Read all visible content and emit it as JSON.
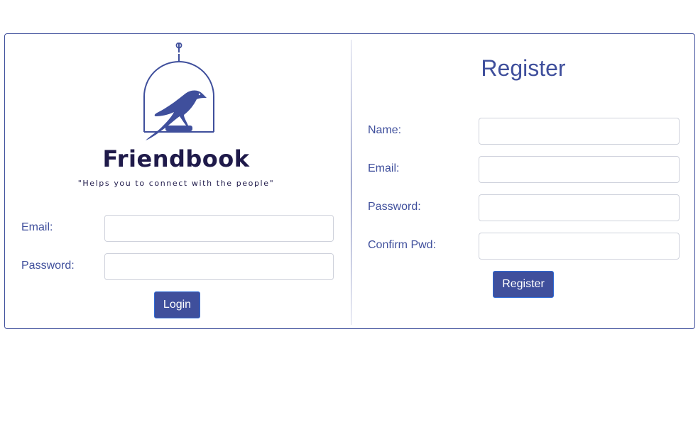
{
  "login": {
    "brand_name": "Friendbook",
    "tagline": "\"Helps you to connect with the people\"",
    "email_label": "Email:",
    "email_value": "",
    "password_label": "Password:",
    "password_value": "",
    "login_button": "Login"
  },
  "register": {
    "title": "Register",
    "name_label": "Name:",
    "name_value": "",
    "email_label": "Email:",
    "email_value": "",
    "password_label": "Password:",
    "password_value": "",
    "confirm_label": "Confirm Pwd:",
    "confirm_value": "",
    "register_button": "Register"
  },
  "icons": {
    "logo": "bird-in-cage-logo"
  },
  "colors": {
    "accent": "#3f4f9c",
    "brand_text": "#1f1a4a",
    "input_border": "#cfd2dc"
  }
}
